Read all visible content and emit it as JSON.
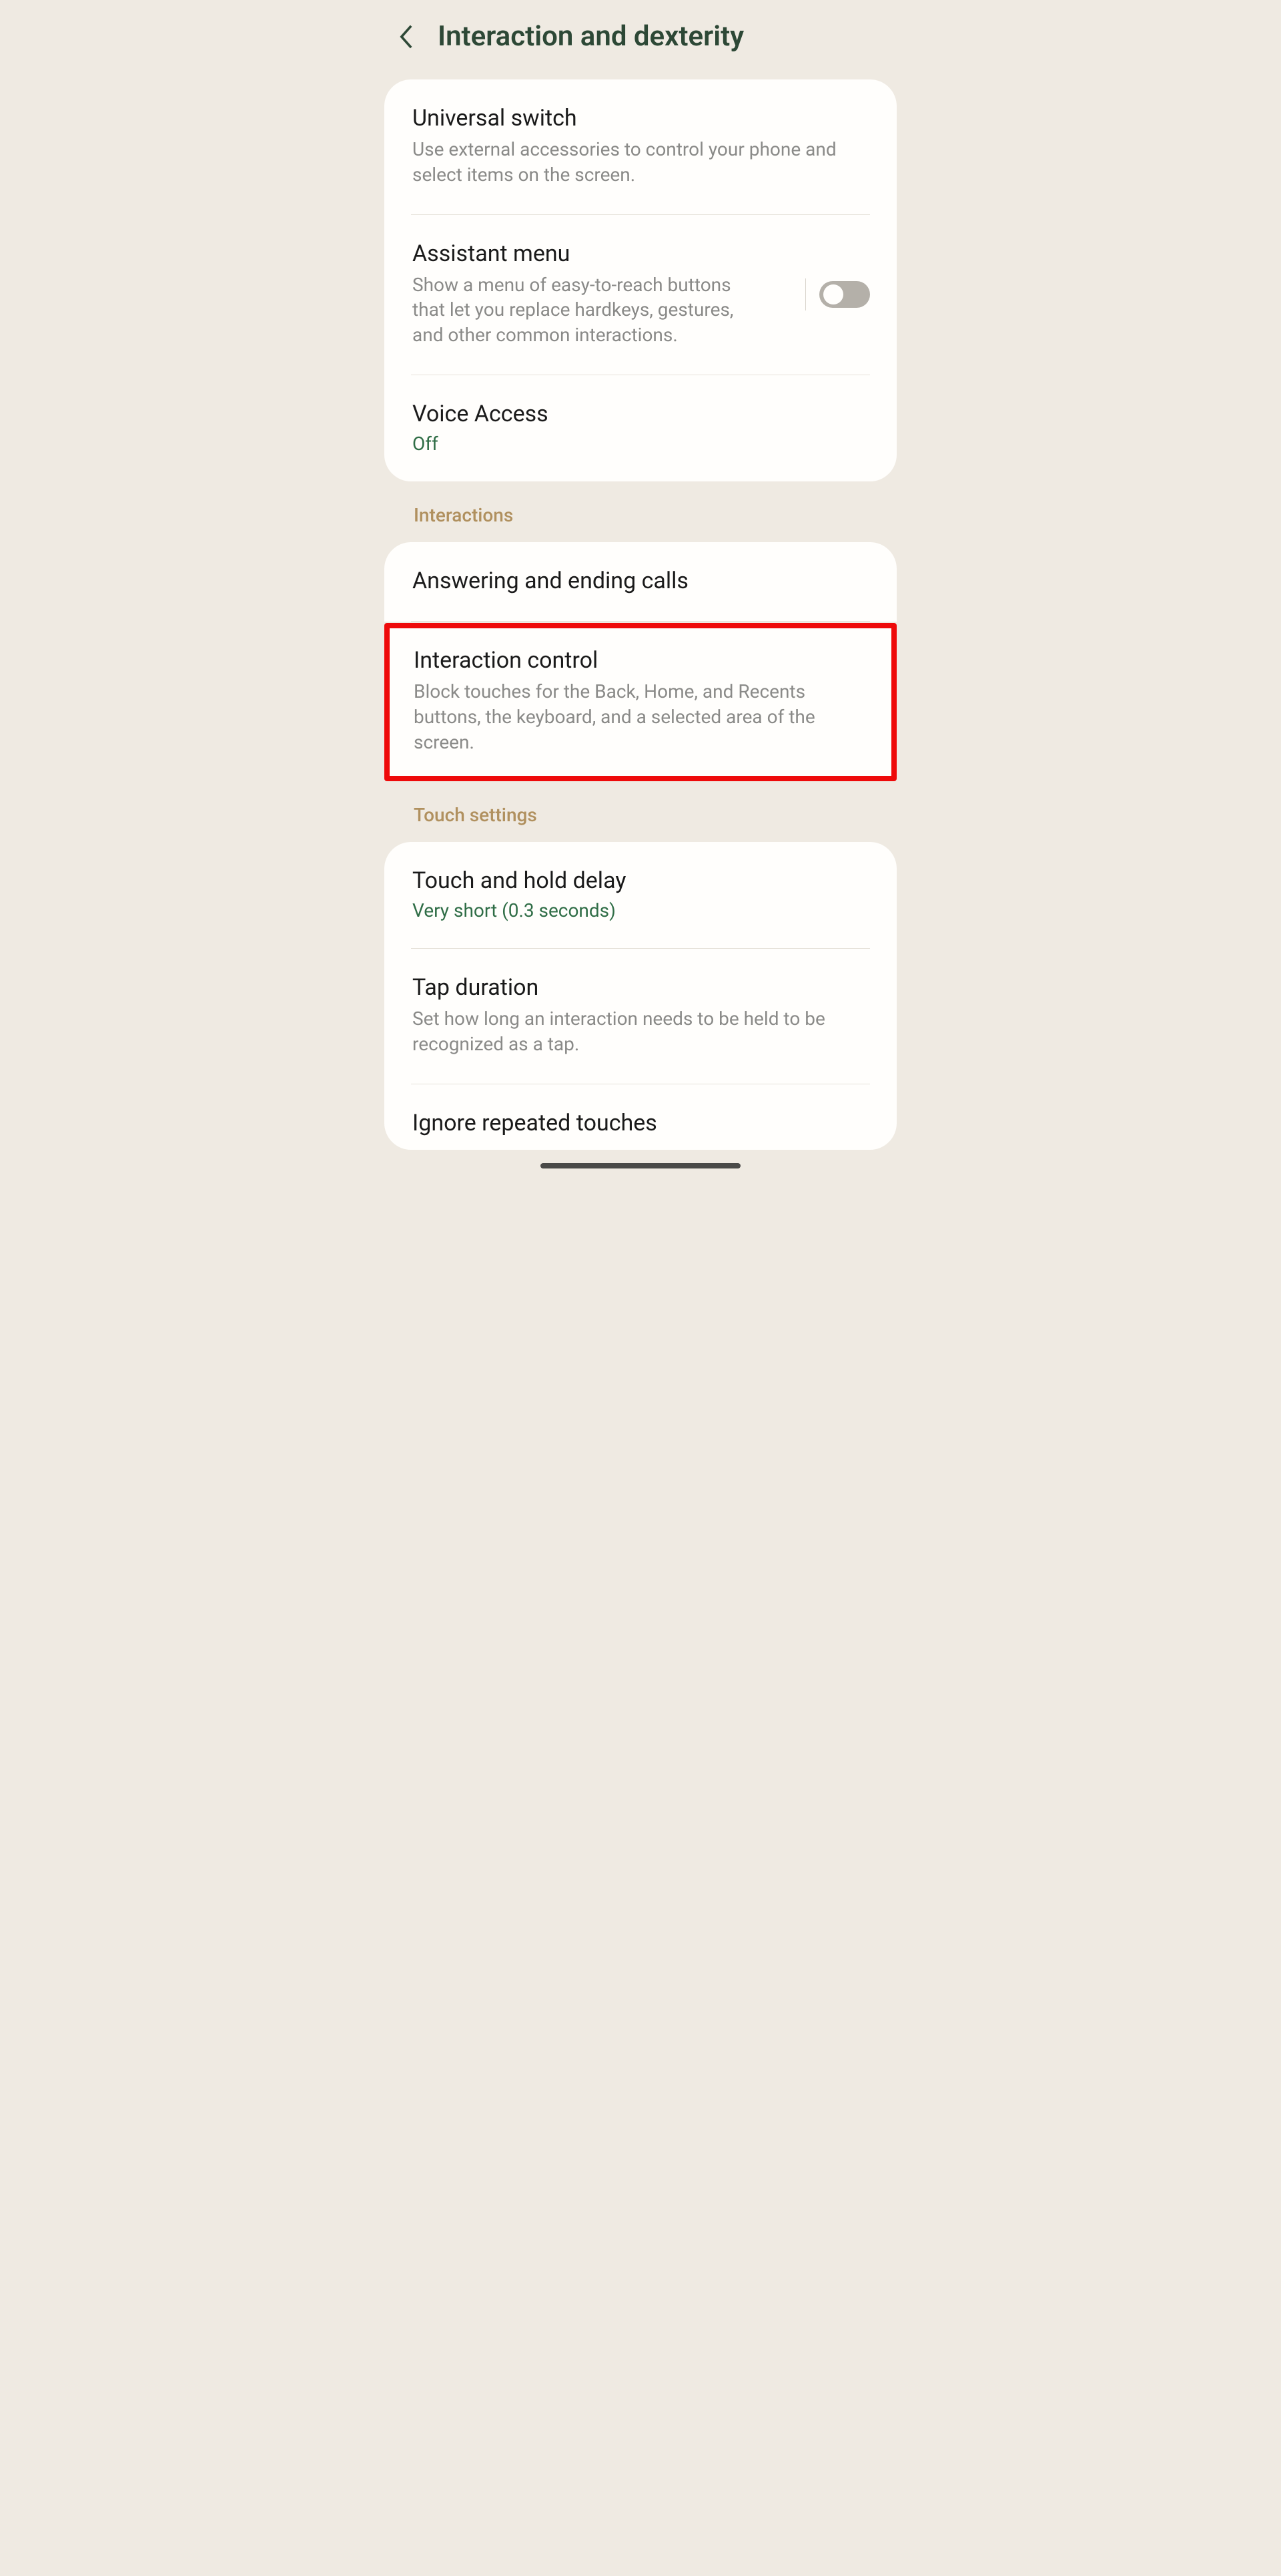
{
  "header": {
    "title": "Interaction and dexterity"
  },
  "group1": {
    "universal_switch": {
      "title": "Universal switch",
      "desc": "Use external accessories to control your phone and select items on the screen."
    },
    "assistant_menu": {
      "title": "Assistant menu",
      "desc": "Show a menu of easy-to-reach buttons that let you replace hardkeys, gestures, and other common interactions.",
      "toggle": false
    },
    "voice_access": {
      "title": "Voice Access",
      "status": "Off"
    }
  },
  "sections": {
    "interactions": "Interactions",
    "touch_settings": "Touch settings"
  },
  "group2": {
    "answering": {
      "title": "Answering and ending calls"
    },
    "interaction_control": {
      "title": "Interaction control",
      "desc": "Block touches for the Back, Home, and Recents buttons, the keyboard, and a selected area of the screen."
    }
  },
  "group3": {
    "touch_hold": {
      "title": "Touch and hold delay",
      "status": "Very short (0.3 seconds)"
    },
    "tap_duration": {
      "title": "Tap duration",
      "desc": "Set how long an interaction needs to be held to be recognized as a tap."
    },
    "ignore_repeated": {
      "title": "Ignore repeated touches"
    }
  }
}
